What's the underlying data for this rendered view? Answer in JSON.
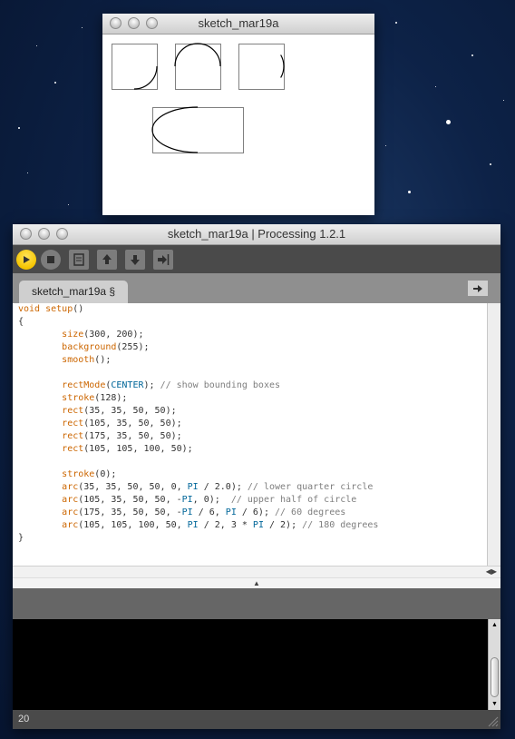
{
  "sketch_window": {
    "title": "sketch_mar19a"
  },
  "processing_window": {
    "title": "sketch_mar19a | Processing 1.2.1",
    "toolbar": {
      "buttons": [
        "run-icon",
        "stop-icon",
        "new-icon",
        "open-icon",
        "save-icon",
        "export-icon"
      ]
    },
    "tab": {
      "label": "sketch_mar19a §"
    },
    "tab_menu_icon": "right-arrow-icon",
    "code_lines": [
      "void setup()",
      "{",
      "        size(300, 200);",
      "        background(255);",
      "        smooth();",
      "",
      "        rectMode(CENTER); // show bounding boxes",
      "        stroke(128);",
      "        rect(35, 35, 50, 50);",
      "        rect(105, 35, 50, 50);",
      "        rect(175, 35, 50, 50);",
      "        rect(105, 105, 100, 50);",
      "",
      "        stroke(0);",
      "        arc(35, 35, 50, 50, 0, PI / 2.0); // lower quarter circle",
      "        arc(105, 35, 50, 50, -PI, 0);  // upper half of circle",
      "        arc(175, 35, 50, 50, -PI / 6, PI / 6); // 60 degrees",
      "        arc(105, 105, 100, 50, PI / 2, 3 * PI / 2); // 180 degrees",
      "}"
    ],
    "status": {
      "line_number": "20"
    },
    "colors": {
      "keyword": "#cc6600",
      "constant": "#006699",
      "comment": "#7e7e7e",
      "run_button": "#f5c400"
    }
  }
}
